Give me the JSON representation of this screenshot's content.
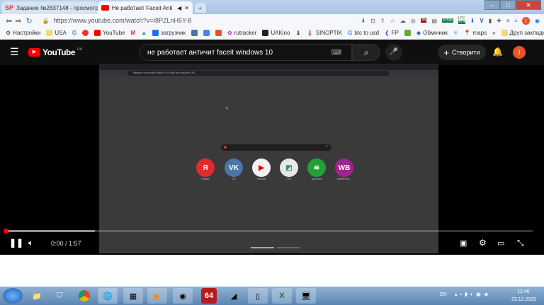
{
  "browser": {
    "tabs": [
      {
        "title": "Задание №2837148 - просмотр з",
        "icon": "sp-icon"
      },
      {
        "title": "Не работает Faceit Anti cheat",
        "icon": "youtube-icon",
        "active": true
      }
    ],
    "url": "https://www.youtube.com/watch?v=I8PZLnH5Y-8",
    "extensions": {
      "badge1": "35",
      "ltc_label": "LTC",
      "price1": "87558",
      "price2": "76.4"
    },
    "bookmarks": [
      "Настройки",
      "USA",
      "",
      "",
      "YouTube",
      "",
      "",
      "загрузчик",
      "",
      "",
      "",
      "rutracker",
      "UAKino",
      "",
      "SINOPTIK",
      "btc to usd",
      "FP",
      "",
      "Обмінник",
      "",
      "maps"
    ],
    "more": "»",
    "other_bookmarks": "Другі закладки"
  },
  "youtube": {
    "logo": "YouTube",
    "region": "UA",
    "search_value": "не работает античит faceit windows 10",
    "create_label": "Створити",
    "avatar_letter": "I",
    "time": "0:00 / 1:57",
    "progress": 0.0,
    "buffered": 0.17,
    "accent": "#ff0000"
  },
  "frame": {
    "omnibox_placeholder": "Введите поисковый запрос в Google или укажите URL",
    "tiles": [
      {
        "label": "Яндекс",
        "text": "Я",
        "color": "#e32a2a"
      },
      {
        "label": "VK",
        "text": "VK",
        "color": "#4a76a8"
      },
      {
        "label": "Youtube",
        "text": "▶",
        "color": "#f1f1f1"
      },
      {
        "label": "PSX",
        "text": "◩",
        "color": "#e8e8e8"
      },
      {
        "label": "Sberbank",
        "text": "≋",
        "color": "#21a038"
      },
      {
        "label": "Wildberries...",
        "text": "WB",
        "color": "#a2238f"
      }
    ]
  },
  "taskbar": {
    "lang": "EN",
    "clock_time": "12:46",
    "clock_date": "23.12.2025",
    "app64": "64"
  }
}
